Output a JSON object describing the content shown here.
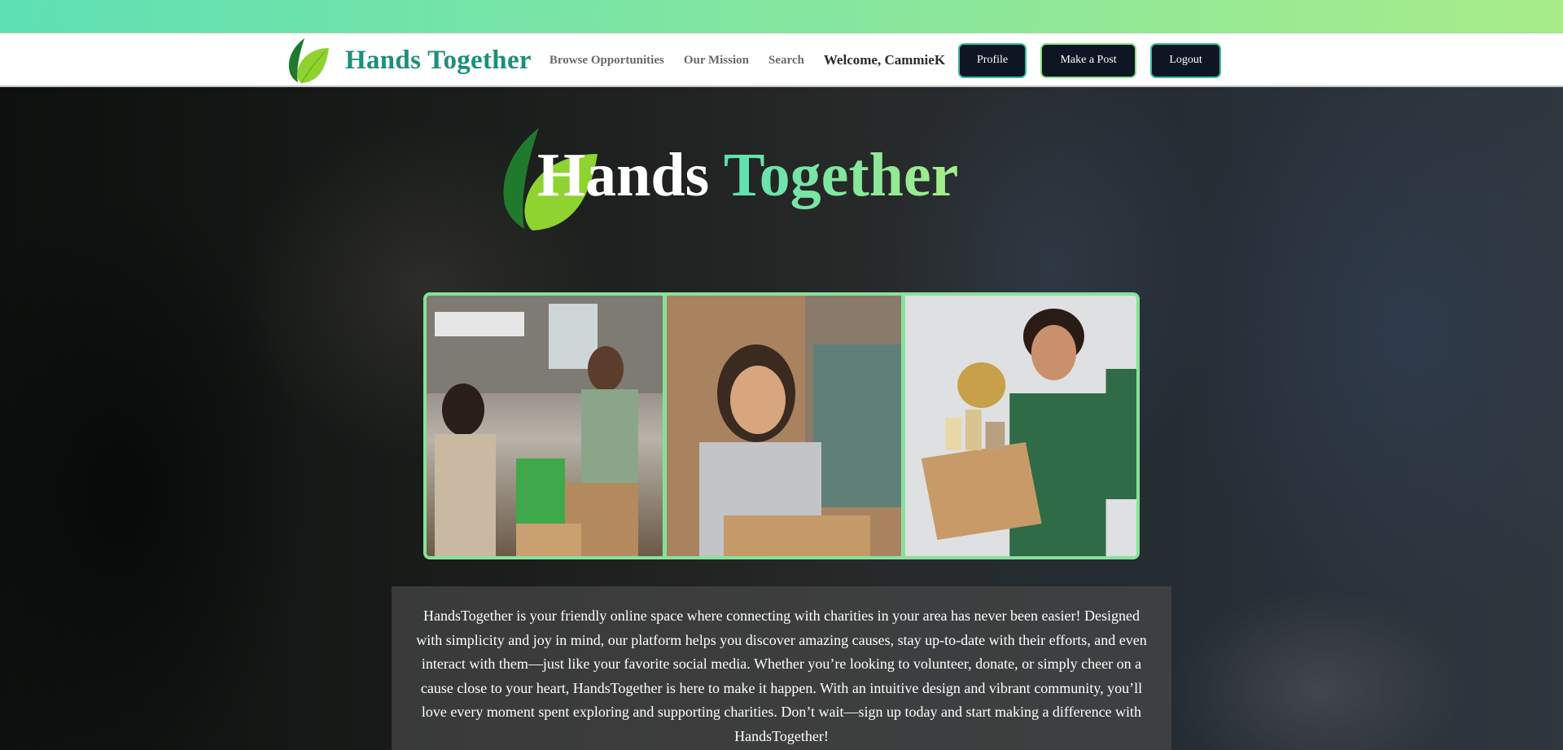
{
  "brand": {
    "name": "Hands Together"
  },
  "nav": {
    "links": [
      "Browse Opportunities",
      "Our Mission",
      "Search"
    ],
    "welcome": "Welcome, CammieK",
    "buttons": {
      "profile": "Profile",
      "post": "Make a Post",
      "logout": "Logout"
    }
  },
  "hero": {
    "title_word1": "Hands",
    "title_word2": "Together"
  },
  "gallery": {
    "photos": [
      "volunteers-food-drive-photo",
      "smiling-volunteer-photo",
      "volunteer-carrying-box-photo"
    ],
    "border_color": "#86e29a"
  },
  "about": {
    "text": "HandsTogether is your friendly online space where connecting with charities in your area has never been easier! Designed with simplicity and joy in mind, our platform helps you discover amazing causes, stay up-to-date with their efforts, and even interact with them—just like your favorite social media. Whether you’re looking to volunteer, donate, or simply cheer on a cause close to your heart, HandsTogether is here to make it happen. With an intuitive design and vibrant community, you’ll love every moment spent exploring and supporting charities. Don’t wait—sign up today and start making a difference with HandsTogether!"
  },
  "colors": {
    "brand_teal": "#1b8f7c",
    "gradient_start": "#5ee0b4",
    "gradient_end": "#a8ec8a",
    "button_bg": "#0d1622"
  }
}
